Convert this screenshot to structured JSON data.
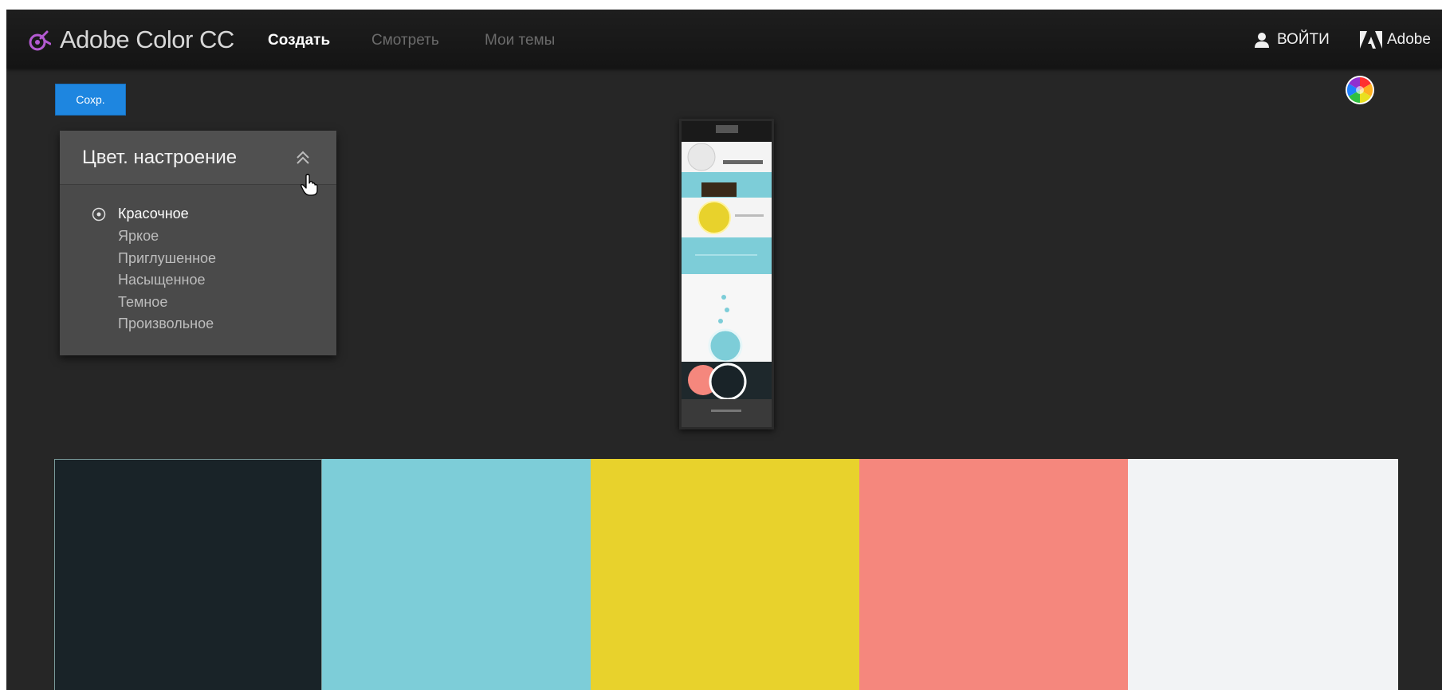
{
  "header": {
    "app_title": "Adobe Color CC",
    "nav": [
      {
        "label": "Создать",
        "active": true
      },
      {
        "label": "Смотреть",
        "active": false
      },
      {
        "label": "Мои темы",
        "active": false
      }
    ],
    "login_label": "ВОЙТИ",
    "adobe_label": "Adobe"
  },
  "toolbar": {
    "save_label": "Сохр."
  },
  "mood_panel": {
    "title": "Цвет. настроение",
    "options": [
      "Красочное",
      "Яркое",
      "Приглушенное",
      "Насыщенное",
      "Темное",
      "Произвольное"
    ],
    "selected": "Красочное"
  },
  "icons": {
    "logo": "adobe-color-logo-icon",
    "login": "user-icon",
    "adobe": "adobe-logo-icon",
    "color_wheel": "color-wheel-icon",
    "collapse": "double-chevron-up-icon",
    "cursor": "hand-pointer-icon",
    "radio": "radio-selected-icon"
  },
  "swatches": [
    {
      "color": "#192328",
      "selected": true
    },
    {
      "color": "#7dcdd8",
      "selected": false
    },
    {
      "color": "#e8d22c",
      "selected": false
    },
    {
      "color": "#f5877d",
      "selected": false
    },
    {
      "color": "#f2f3f5",
      "selected": false
    }
  ],
  "colors": {
    "accent": "#1e86e0",
    "logo": "#b45ad2",
    "background": "#262626"
  }
}
